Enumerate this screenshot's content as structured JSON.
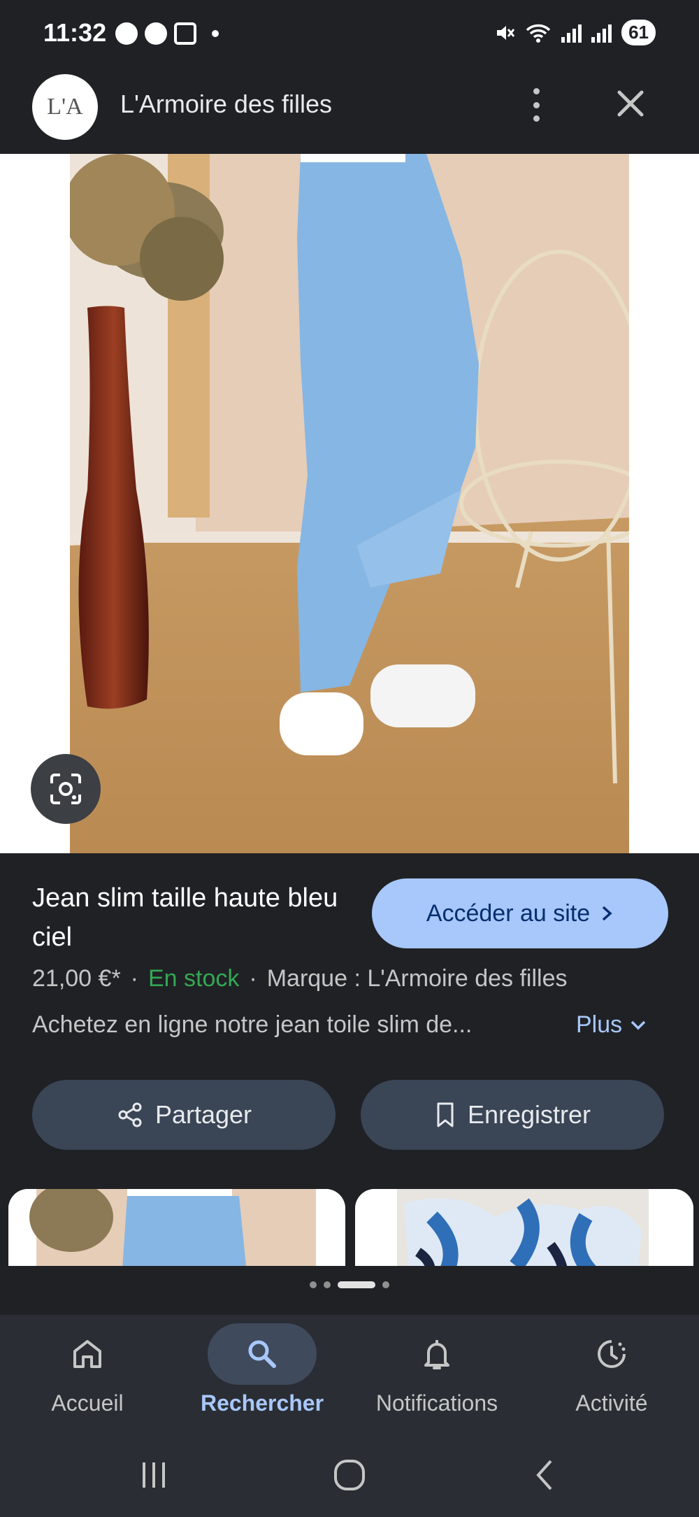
{
  "status_bar": {
    "time": "11:32",
    "battery": "61"
  },
  "header": {
    "logo_text": "L'A",
    "site_name": "L'Armoire des filles"
  },
  "product": {
    "title": "Jean slim taille haute bleu ciel",
    "visit_label": "Accéder au site",
    "price": "21,00 €*",
    "stock": "En stock",
    "brand": "Marque : L'Armoire des filles",
    "description": "Achetez en ligne notre jean toile slim de...",
    "more_label": "Plus",
    "share_label": "Partager",
    "save_label": "Enregistrer"
  },
  "bottom_nav": {
    "items": [
      {
        "label": "Accueil",
        "icon": "home-icon"
      },
      {
        "label": "Rechercher",
        "icon": "search-icon",
        "active": true
      },
      {
        "label": "Notifications",
        "icon": "bell-icon"
      },
      {
        "label": "Activité",
        "icon": "activity-icon"
      }
    ]
  },
  "colors": {
    "accent": "#a8c7fa",
    "stock_green": "#34a853",
    "background": "#1f2125"
  }
}
